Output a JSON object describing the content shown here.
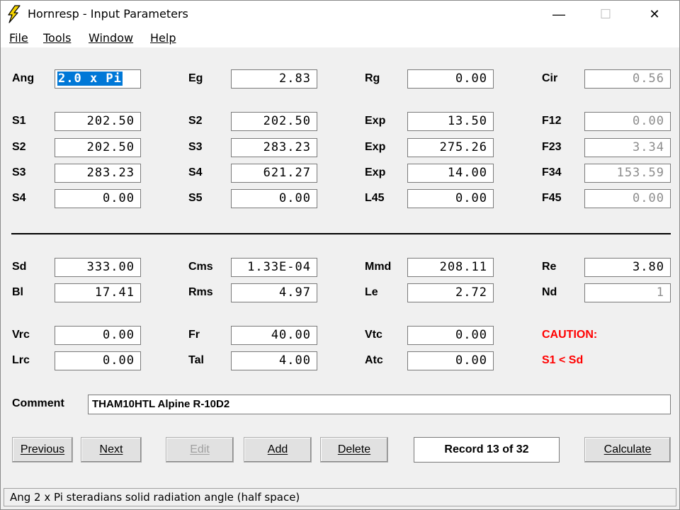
{
  "window": {
    "title": "Hornresp - Input Parameters"
  },
  "titlebar": {
    "minimize": "—",
    "maximize": "☐",
    "close": "✕"
  },
  "menu": [
    "File",
    "Tools",
    "Window",
    "Help"
  ],
  "row0": [
    {
      "label": "Ang",
      "value": "2.0 x Pi"
    },
    {
      "label": "Eg",
      "value": "2.83"
    },
    {
      "label": "Rg",
      "value": "0.00"
    },
    {
      "label": "Cir",
      "value": "0.56"
    }
  ],
  "rows": [
    [
      {
        "label": "S1",
        "value": "202.50"
      },
      {
        "label": "S2",
        "value": "202.50"
      },
      {
        "label": "Exp",
        "value": "13.50"
      },
      {
        "label": "F12",
        "value": "0.00"
      }
    ],
    [
      {
        "label": "S2",
        "value": "202.50"
      },
      {
        "label": "S3",
        "value": "283.23"
      },
      {
        "label": "Exp",
        "value": "275.26"
      },
      {
        "label": "F23",
        "value": "3.34"
      }
    ],
    [
      {
        "label": "S3",
        "value": "283.23"
      },
      {
        "label": "S4",
        "value": "621.27"
      },
      {
        "label": "Exp",
        "value": "14.00"
      },
      {
        "label": "F34",
        "value": "153.59"
      }
    ],
    [
      {
        "label": "S4",
        "value": "0.00"
      },
      {
        "label": "S5",
        "value": "0.00"
      },
      {
        "label": "L45",
        "value": "0.00"
      },
      {
        "label": "F45",
        "value": "0.00"
      }
    ]
  ],
  "driver1": [
    {
      "label": "Sd",
      "value": "333.00"
    },
    {
      "label": "Cms",
      "value": "1.33E-04"
    },
    {
      "label": "Mmd",
      "value": "208.11"
    },
    {
      "label": "Re",
      "value": "3.80"
    }
  ],
  "driver2": [
    {
      "label": "Bl",
      "value": "17.41"
    },
    {
      "label": "Rms",
      "value": "4.97"
    },
    {
      "label": "Le",
      "value": "2.72"
    },
    {
      "label": "Nd",
      "value": "1"
    }
  ],
  "chamber1": [
    {
      "label": "Vrc",
      "value": "0.00"
    },
    {
      "label": "Fr",
      "value": "40.00"
    },
    {
      "label": "Vtc",
      "value": "0.00"
    }
  ],
  "chamber2": [
    {
      "label": "Lrc",
      "value": "0.00"
    },
    {
      "label": "Tal",
      "value": "4.00"
    },
    {
      "label": "Atc",
      "value": "0.00"
    }
  ],
  "warning": {
    "line1": "CAUTION:",
    "line2": "S1 < Sd",
    "color": "#ff0000"
  },
  "comment": {
    "label": "Comment",
    "value": "THAM10HTL Alpine R-10D2"
  },
  "buttons": {
    "previous": "Previous",
    "next": "Next",
    "edit": "Edit",
    "add": "Add",
    "delete": "Delete",
    "record": "Record 13 of 32",
    "calculate": "Calculate"
  },
  "status": "Ang   2 x Pi steradians solid radiation angle  (half space)"
}
